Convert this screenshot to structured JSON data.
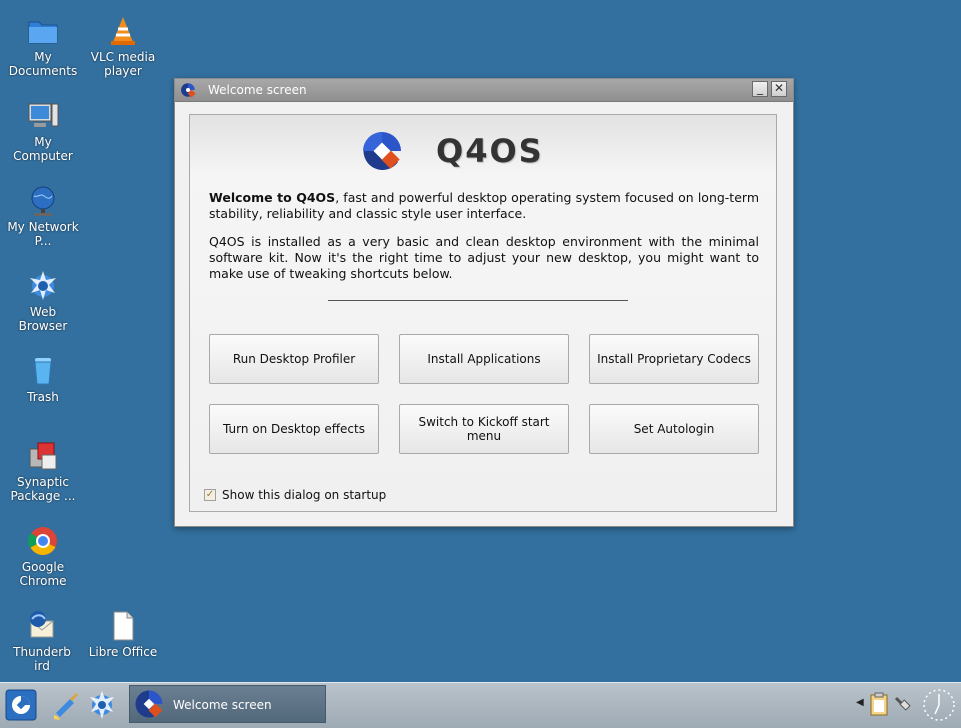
{
  "desktop": {
    "icons": [
      {
        "label": "My Documents",
        "icon": "folder-icon"
      },
      {
        "label": "VLC media player",
        "icon": "vlc-cone-icon"
      },
      {
        "label": "My Computer",
        "icon": "computer-icon"
      },
      {
        "label": "My Network P...",
        "icon": "network-globe-icon"
      },
      {
        "label": "Web Browser",
        "icon": "web-browser-icon"
      },
      {
        "label": "Trash",
        "icon": "trash-icon"
      },
      {
        "label": "Synaptic Package ...",
        "icon": "synaptic-package-icon"
      },
      {
        "label": "Google Chrome",
        "icon": "chrome-icon"
      },
      {
        "label": "Thunderbird",
        "icon": "thunderbird-icon"
      },
      {
        "label": "Libre Office",
        "icon": "libreoffice-icon"
      }
    ]
  },
  "window": {
    "title": "Welcome screen",
    "minimize_glyph": "_",
    "close_glyph": "✕",
    "logo_text": "Q4OS",
    "intro_bold": "Welcome to Q4OS",
    "intro_rest": ", fast and powerful desktop operating system focused on long-term stability, reliability and classic style user interface.",
    "paragraph2": "Q4OS is installed as a very basic and clean desktop environment with the minimal software kit. Now it's the right time to adjust your new desktop, you might want to make use of tweaking shortcuts below.",
    "buttons": {
      "run_profiler": "Run Desktop Profiler",
      "install_apps": "Install Applications",
      "install_codecs": "Install Proprietary Codecs",
      "desktop_effects": "Turn on Desktop effects",
      "kickoff": "Switch to Kickoff start menu",
      "autologin": "Set Autologin"
    },
    "startup_checkbox": {
      "label": "Show this dialog on startup",
      "checked": true,
      "glyph": "✓"
    }
  },
  "taskbar": {
    "task_label": "Welcome screen",
    "tray_arrow": "◀"
  },
  "colors": {
    "desktop": "#33709f",
    "logo_blue": "#1e3b8c",
    "logo_orange": "#e0501e"
  }
}
